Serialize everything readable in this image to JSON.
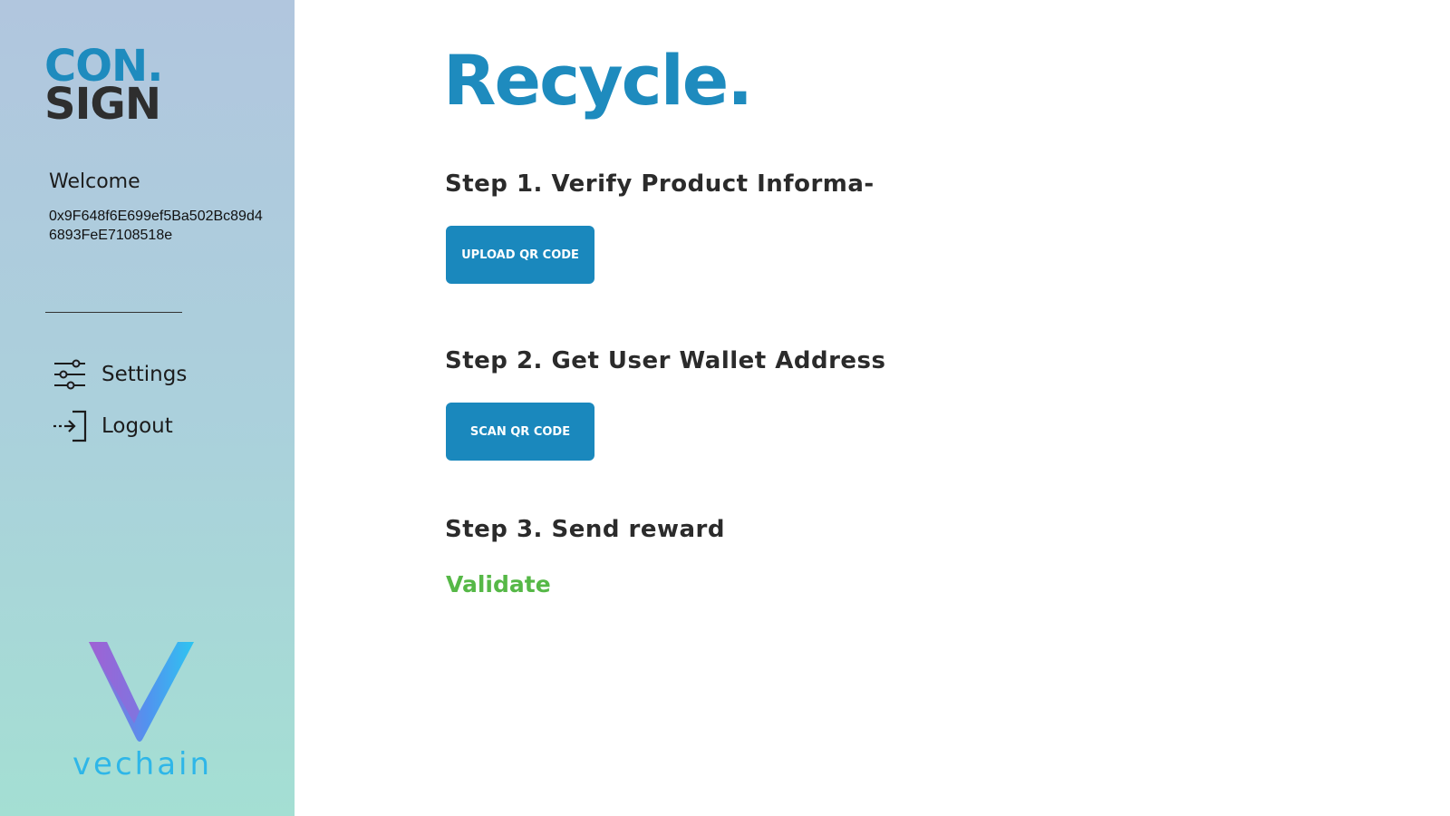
{
  "sidebar": {
    "brand": {
      "line1": "CON",
      "dot": ".",
      "line2": "SIGN"
    },
    "welcome": "Welcome",
    "address": "0x9F648f6E699ef5Ba502Bc89d46893FeE7108518e",
    "nav": [
      {
        "label": "Settings",
        "icon": "sliders-icon"
      },
      {
        "label": "Logout",
        "icon": "logout-icon"
      }
    ],
    "partner_logo_text": "vechain"
  },
  "main": {
    "title": "Recycle.",
    "steps": [
      {
        "heading": "Step 1. Verify Product Informa-",
        "action_label": "UPLOAD QR CODE"
      },
      {
        "heading": "Step 2. Get User Wallet Address",
        "action_label": "SCAN QR CODE"
      },
      {
        "heading": "Step 3. Send reward",
        "action_label": "Validate"
      }
    ]
  },
  "colors": {
    "brand_blue": "#1e8bbe",
    "button_blue": "#1a88bd",
    "dark_text": "#2b2b2b",
    "validate_green": "#56b847",
    "sidebar_gradient_top": "#b1c6de",
    "sidebar_gradient_bottom": "#a4dfd3"
  }
}
